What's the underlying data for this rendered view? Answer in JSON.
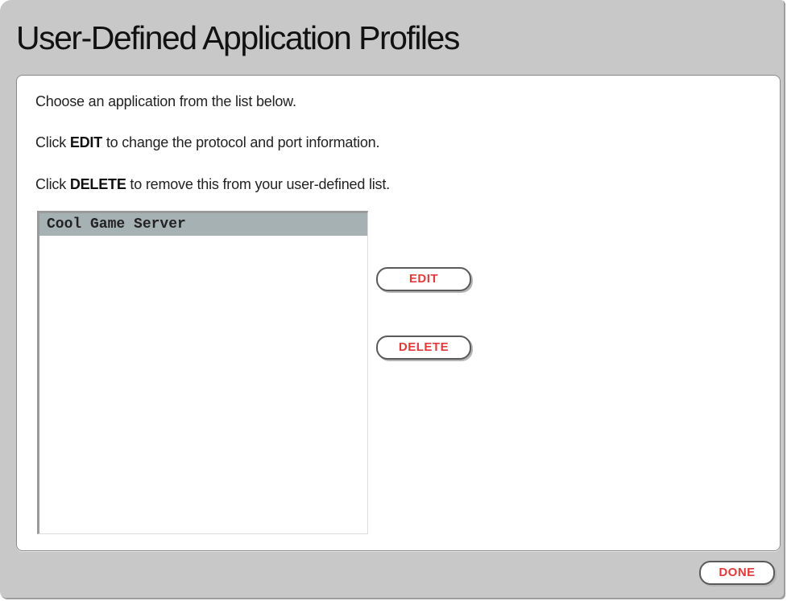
{
  "title": "User-Defined Application Profiles",
  "instructions": {
    "line1": "Choose an application from the list below.",
    "line2": {
      "prefix": "Click ",
      "keyword": "EDIT",
      "suffix": " to change the protocol and port information."
    },
    "line3": {
      "prefix": "Click ",
      "keyword": "DELETE",
      "suffix": " to remove this from your user-defined list."
    }
  },
  "application_list": {
    "items": [
      {
        "label": "Cool Game Server",
        "selected": true
      }
    ]
  },
  "buttons": {
    "edit": "EDIT",
    "delete": "DELETE",
    "done": "DONE"
  },
  "colors": {
    "button_text": "#e23a3a",
    "selected_row": "#a6b1b3",
    "window_background": "#c8c8c8"
  }
}
